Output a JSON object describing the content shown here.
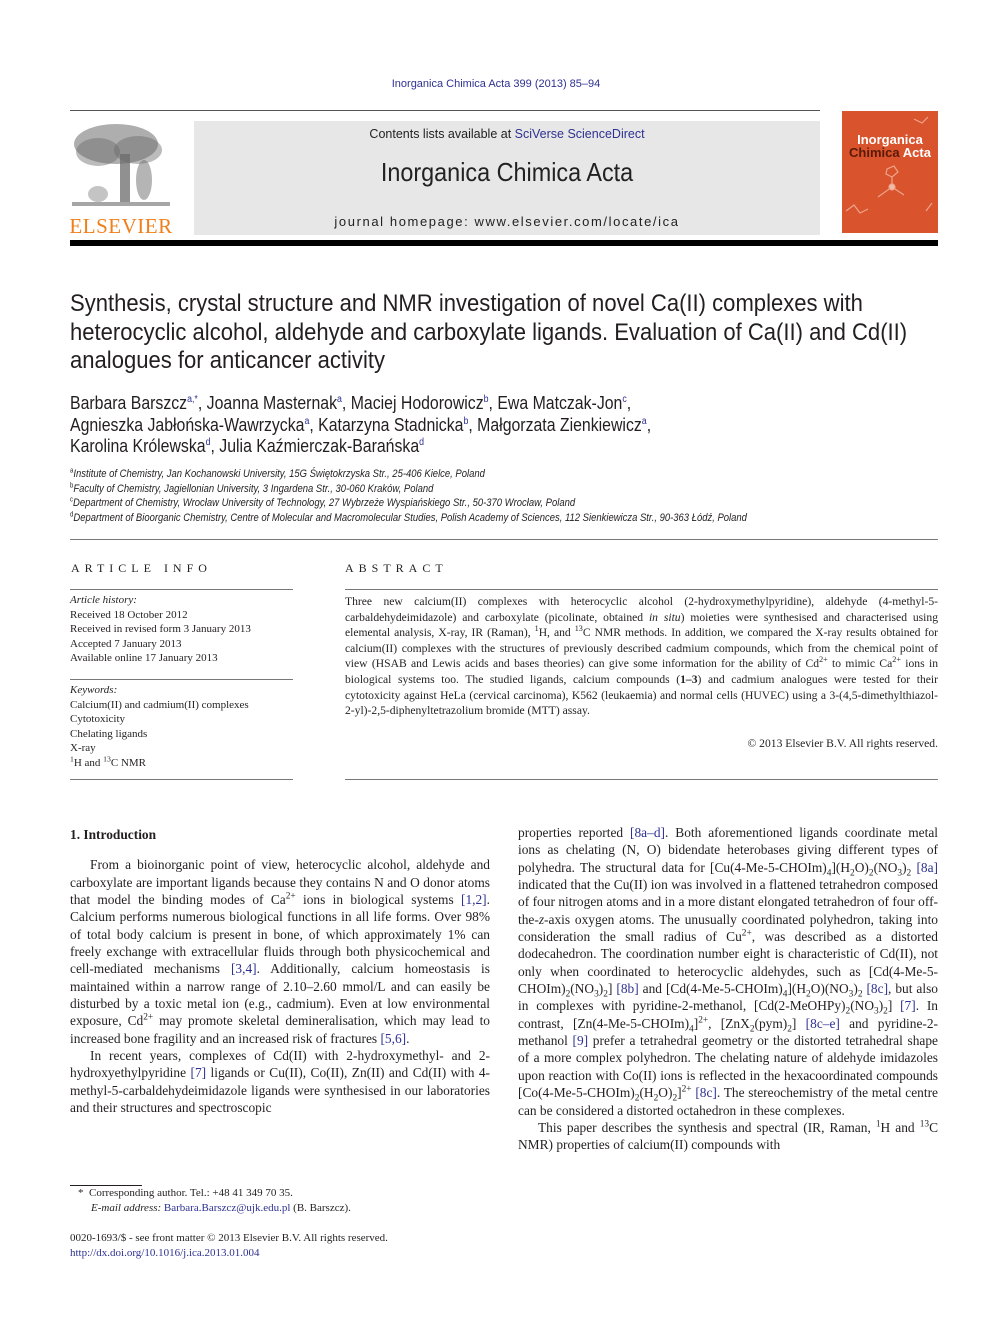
{
  "header": {
    "journal_reference": "Inorganica Chimica Acta 399 (2013) 85–94",
    "publisher_logo_text": "ELSEVIER",
    "contents_prefix": "Contents lists available at ",
    "contents_link": "SciVerse ScienceDirect",
    "journal_name": "Inorganica Chimica Acta",
    "homepage": "journal homepage: www.elsevier.com/locate/ica",
    "cover": {
      "title_line1": "Inorganica",
      "title_line2_a": "Chimica",
      "title_line2_b": "Acta",
      "color": "#d9532c"
    },
    "colors": {
      "link": "#2e3192",
      "logo": "#f07f1b",
      "banner": "#e7e7e7"
    }
  },
  "article": {
    "title": "Synthesis, crystal structure and NMR investigation of novel Ca(II) complexes with heterocyclic alcohol, aldehyde and carboxylate ligands. Evaluation of Ca(II) and Cd(II) analogues for anticancer activity",
    "authors": [
      {
        "name": "Barbara Barszcz",
        "sup": "a,*"
      },
      {
        "name": "Joanna Masternak",
        "sup": "a"
      },
      {
        "name": "Maciej Hodorowicz",
        "sup": "b"
      },
      {
        "name": "Ewa Matczak-Jon",
        "sup": "c"
      },
      {
        "name": "Agnieszka Jabłońska-Wawrzycka",
        "sup": "a"
      },
      {
        "name": "Katarzyna Stadnicka",
        "sup": "b"
      },
      {
        "name": "Małgorzata Zienkiewicz",
        "sup": "a"
      },
      {
        "name": "Karolina Królewska",
        "sup": "d"
      },
      {
        "name": "Julia Kaźmierczak-Barańska",
        "sup": "d"
      }
    ],
    "affiliations": [
      {
        "key": "a",
        "text": "Institute of Chemistry, Jan Kochanowski University, 15G Świętokrzyska Str., 25-406 Kielce, Poland"
      },
      {
        "key": "b",
        "text": "Faculty of Chemistry, Jagiellonian University, 3 Ingardena Str., 30-060 Kraków, Poland"
      },
      {
        "key": "c",
        "text": "Department of Chemistry, Wrocław University of Technology, 27 Wybrzeże Wyspiańskiego Str., 50-370 Wrocław, Poland"
      },
      {
        "key": "d",
        "text": "Department of Bioorganic Chemistry, Centre of Molecular and Macromolecular Studies, Polish Academy of Sciences, 112 Sienkiewicza Str., 90-363 Łódź, Poland"
      }
    ]
  },
  "article_info": {
    "heading": "ARTICLE INFO",
    "history_label": "Article history:",
    "history": [
      "Received 18 October 2012",
      "Received in revised form 3 January 2013",
      "Accepted 7 January 2013",
      "Available online 17 January 2013"
    ],
    "keywords_label": "Keywords:",
    "keywords": [
      "Calcium(II) and cadmium(II) complexes",
      "Cytotoxicity",
      "Chelating ligands",
      "X-ray"
    ],
    "keyword_nmr": {
      "sup1": "1",
      "mid": "H and ",
      "sup2": "13",
      "end": "C NMR"
    }
  },
  "abstract": {
    "heading": "ABSTRACT",
    "t1": "Three new calcium(II) complexes with heterocyclic alcohol (2-hydroxymethylpyridine), aldehyde (4-methyl-5-carbaldehydeimidazole) and carboxylate (picolinate, obtained ",
    "t1_ital": "in situ",
    "t2": ") moieties were synthesised and characterised using elemental analysis, X-ray, IR (Raman), ",
    "sup_1": "1",
    "t3": "H, and ",
    "sup_13": "13",
    "t4": "C NMR methods. In addition, we compared the X-ray results obtained for calcium(II) complexes with the structures of previously described cadmium compounds, which from the chemical point of view (HSAB and Lewis acids and bases theories) can give some information for the ability of Cd",
    "sup_cd": "2+",
    "t5": " to mimic Ca",
    "sup_ca": "2+",
    "t6": " ions in biological systems too. The studied ligands, calcium compounds (",
    "bold": "1–3",
    "t7": ") and cadmium analogues were tested for their cytotoxicity against HeLa (cervical carcinoma), K562 (leukaemia) and normal cells (HUVEC) using a 3-(4,5-dimethylthiazol-2-yl)-2,5-diphenyltetrazolium bromide (MTT) assay.",
    "copyright": "© 2013 Elsevier B.V. All rights reserved."
  },
  "body": {
    "section_heading": "1. Introduction",
    "p1": {
      "a": "From a bioinorganic point of view, heterocyclic alcohol, aldehyde and carboxylate are important ligands because they contains N and O donor atoms that model the binding modes of Ca",
      "sup1": "2+",
      "b": " ions in biological systems ",
      "ref1": "[1,2]",
      "c": ". Calcium performs numerous biological functions in all life forms. Over 98% of total body calcium is present in bone, of which approximately 1% can freely exchange with extracellular fluids through both physicochemical and cell-mediated mechanisms ",
      "ref2": "[3,4]",
      "d": ". Additionally, calcium homeostasis is maintained within a narrow range of 2.10–2.60 mmol/L and can easily be disturbed by a toxic metal ion (e.g., cadmium). Even at low environmental exposure, Cd",
      "sup2": "2+",
      "e": " may promote skeletal demineralisation, which may lead to increased bone fragility and an increased risk of fractures ",
      "ref3": "[5,6]",
      "f": "."
    },
    "p2": {
      "a": "In recent years, complexes of Cd(II) with 2-hydroxymethyl- and 2-hydroxyethylpyridine ",
      "ref1": "[7]",
      "b": " ligands or Cu(II), Co(II), Zn(II) and Cd(II) with 4-methyl-5-carbaldehydeimidazole ligands were synthesised in our laboratories and their structures and spectroscopic properties reported ",
      "ref2": "[8a–d]",
      "c": ". Both aforementioned ligands coordinate metal ions as chelating (N, O) bidendate heterobases giving different types of polyhedra. The structural data for [Cu(4-Me-5-CHOIm)",
      "sub1": "4",
      "c2": "](H",
      "sub2": "2",
      "c3": "O)",
      "sub3": "2",
      "c4": "(NO",
      "sub4": "3",
      "c5": ")",
      "sub5": "2",
      "c6": " ",
      "ref3": "[8a]",
      "d": " indicated that the Cu(II) ion was involved in a flattened tetrahedron composed of four nitrogen atoms and in a more distant elongated tetrahedron of four off-the-",
      "d_ital": "z",
      "d2": "-axis oxygen atoms. The unusually coordinated polyhedron, taking into consideration the small radius of Cu",
      "sup1": "2+",
      "e": ", was described as a distorted dodecahedron. The coordination number eight is characteristic of Cd(II), not only when coordinated to heterocyclic aldehydes, such as [Cd(4-Me-5-CHOIm)",
      "sub6": "2",
      "e2": "(NO",
      "sub7": "3",
      "e3": ")",
      "sub8": "2",
      "e4": "] ",
      "ref4": "[8b]",
      "f": " and [Cd(4-Me-5-CHOIm)",
      "sub9": "4",
      "f2": "](H",
      "sub10": "2",
      "f3": "O)(NO",
      "sub11": "3",
      "f4": ")",
      "sub12": "2",
      "f5": " ",
      "ref5": "[8c]",
      "g": ", but also in complexes with pyridine-2-methanol, [Cd(2-MeOHPy)",
      "sub13": "2",
      "g2": "(NO",
      "sub14": "3",
      "g3": ")",
      "sub15": "2",
      "g4": "] ",
      "ref6": "[7]",
      "h": ". In contrast, [Zn(4-Me-5-CHOIm)",
      "sub16": "4",
      "h2": "]",
      "sup2": "2+",
      "h3": ", [ZnX",
      "sub17": "2",
      "h4": "(pym)",
      "sub18": "2",
      "h5": "] ",
      "ref7": "[8c–e]",
      "i": " and pyridine-2-methanol ",
      "ref8": "[9]",
      "j": " prefer a tetrahedral geometry or the distorted tetrahedral shape of a more complex polyhedron. The chelating nature of aldehyde imidazoles upon reaction with Co(II) ions is reflected in the hexacoordinated compounds [Co(4-Me-5-CHOIm)",
      "sub19": "2",
      "j2": "(H",
      "sub20": "2",
      "j3": "O)",
      "sub21": "2",
      "j4": "]",
      "sup3": "2+",
      "j5": " ",
      "ref9": "[8c]",
      "k": ". The stereochemistry of the metal centre can be considered a distorted octahedron in these complexes."
    },
    "p3": {
      "a": "This paper describes the synthesis and spectral (IR, Raman, ",
      "sup1": "1",
      "b": "H and ",
      "sup2": "13",
      "c": "C NMR) properties of calcium(II) compounds with"
    }
  },
  "footnotes": {
    "star": "*",
    "corresponding": "Corresponding author. Tel.: +48 41 349 70 35.",
    "email_label": "E-mail address:",
    "email": "Barbara.Barszcz@ujk.edu.pl",
    "email_suffix": " (B. Barszcz).",
    "front_matter": "0020-1693/$ - see front matter © 2013 Elsevier B.V. All rights reserved.",
    "doi": "http://dx.doi.org/10.1016/j.ica.2013.01.004"
  }
}
